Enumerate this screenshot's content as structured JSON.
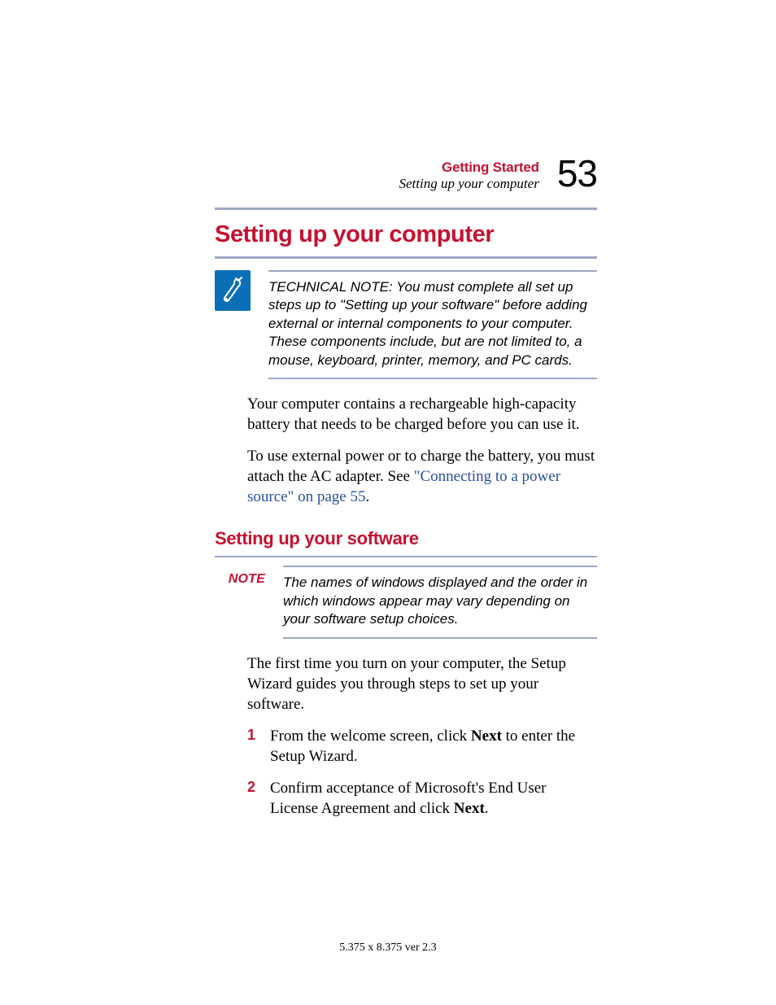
{
  "header": {
    "chapter": "Getting Started",
    "section": "Setting up your computer",
    "page_number": "53"
  },
  "title": "Setting up your computer",
  "technical_note": "TECHNICAL NOTE: You must complete all set up steps up to \"Setting up your software\" before adding external or internal components to your computer. These components include, but are not limited to, a mouse, keyboard, printer, memory, and PC cards.",
  "body": {
    "p1": "Your computer contains a rechargeable high-capacity battery that needs to be charged before you can use it.",
    "p2_a": "To use external power or to charge the battery, you must attach the AC adapter. See ",
    "p2_link": "\"Connecting to a power source\" on page 55",
    "p2_b": "."
  },
  "subsection_title": "Setting up your software",
  "note": {
    "label": "NOTE",
    "text": "The names of windows displayed and the order in which windows appear may vary depending on your software setup choices."
  },
  "setup_intro": "The first time you turn on your computer, the Setup Wizard guides you through steps to set up your software.",
  "steps": {
    "s1_a": "From the welcome screen, click ",
    "s1_bold": "Next",
    "s1_b": " to enter the Setup Wizard.",
    "s2_a": "Confirm acceptance of Microsoft's End User License Agreement and click ",
    "s2_bold": "Next",
    "s2_b": "."
  },
  "footer": "5.375 x 8.375 ver 2.3"
}
